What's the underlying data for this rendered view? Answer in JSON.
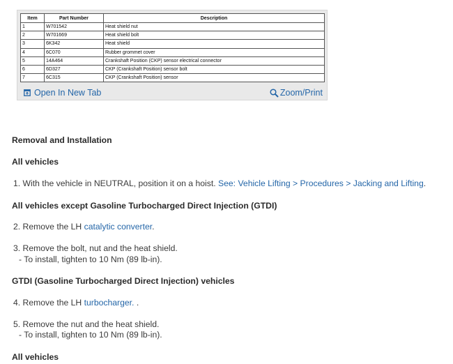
{
  "figure": {
    "table": {
      "headers": [
        "Item",
        "Part Number",
        "Description"
      ],
      "rows": [
        [
          "1",
          "W701542",
          "Heat shield nut"
        ],
        [
          "2",
          "W701669",
          "Heat shield bolt"
        ],
        [
          "3",
          "6K342",
          "Heat shield"
        ],
        [
          "4",
          "6C070",
          "Rubber grommet cover"
        ],
        [
          "5",
          "14A464",
          "Crankshaft Position (CKP) sensor electrical connector"
        ],
        [
          "6",
          "6D327",
          "CKP (Crankshaft Position) sensor bolt"
        ],
        [
          "7",
          "6C315",
          "CKP (Crankshaft Position) sensor"
        ]
      ]
    },
    "open_tab_label": "Open In New Tab",
    "zoom_label": "Zoom/Print",
    "open_tab_icon": "open-tab-icon",
    "zoom_icon": "magnifier-icon",
    "link_color": "#2466a8"
  },
  "section_title": "Removal and Installation",
  "groups": {
    "all_vehicles_1": "All vehicles",
    "non_gtdi": "All vehicles except Gasoline Turbocharged Direct Injection (GTDI)",
    "gtdi": "GTDI (Gasoline Turbocharged Direct Injection) vehicles",
    "all_vehicles_2": "All vehicles"
  },
  "steps": {
    "s1": {
      "text": "1. With the vehicle in NEUTRAL, position it on a hoist. ",
      "link": "See: Vehicle Lifting > Procedures > Jacking and Lifting",
      "after": "."
    },
    "s2": {
      "text": "2. Remove the LH ",
      "link": "catalytic converter",
      "after": "."
    },
    "s3": {
      "text": "3. Remove the bolt, nut and the heat shield.",
      "note": "-  To install, tighten to 10 Nm (89 lb-in)."
    },
    "s4": {
      "text": "4. Remove the LH ",
      "link": "turbocharger.",
      "after": " ."
    },
    "s5": {
      "text": "5. Remove the nut and the heat shield.",
      "note": "-  To install, tighten to 10 Nm (89 lb-in)."
    }
  }
}
